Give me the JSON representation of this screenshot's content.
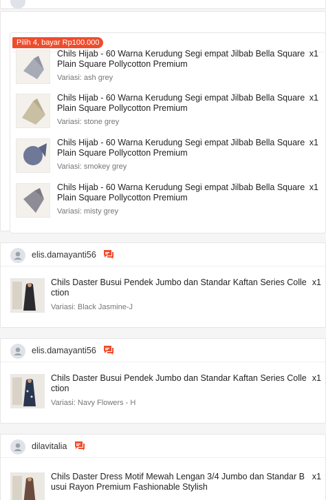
{
  "bundle": {
    "badge": "Pilih 4, bayar Rp100.000",
    "items": [
      {
        "title": "Chils Hijab - 60 Warna Kerudung Segi empat Jilbab Bella Square Plain Square Pollycotton Premium",
        "qty": "x1",
        "variant": "Variasi: ash grey"
      },
      {
        "title": "Chils Hijab - 60 Warna Kerudung Segi empat Jilbab Bella Square Plain Square Pollycotton Premium",
        "qty": "x1",
        "variant": "Variasi: stone grey"
      },
      {
        "title": "Chils Hijab - 60 Warna Kerudung Segi empat Jilbab Bella Square Plain Square Pollycotton Premium",
        "qty": "x1",
        "variant": "Variasi: smokey grey"
      },
      {
        "title": "Chils Hijab - 60 Warna Kerudung Segi empat Jilbab Bella Square Plain Square Pollycotton Premium",
        "qty": "x1",
        "variant": "Variasi: misty grey"
      }
    ]
  },
  "orders": [
    {
      "buyer": "elis.damayanti56",
      "title": "Chils Daster Busui Pendek Jumbo dan Standar Kaftan Series Colle ction",
      "qty": "x1",
      "variant": "Variasi: Black Jasmine-J"
    },
    {
      "buyer": "elis.damayanti56",
      "title": "Chils Daster Busui Pendek Jumbo dan Standar Kaftan Series Colle ction",
      "qty": "x1",
      "variant": "Variasi: Navy Flowers - H"
    },
    {
      "buyer": "dilavitalia",
      "title": "Chils Daster Dress Motif Mewah Lengan 3/4 Jumbo dan Standar B usui Rayon Premium Fashionable Stylish",
      "qty": "x1",
      "variant": ""
    }
  ],
  "colors": {
    "accent": "#ee4d2d"
  },
  "icons": {
    "chat": "chat-bubble-icon",
    "avatar": "user-avatar-icon"
  }
}
